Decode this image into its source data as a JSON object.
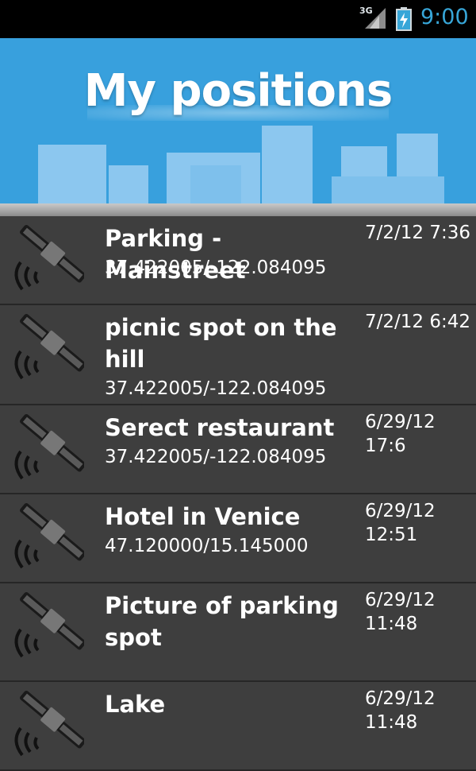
{
  "status_bar": {
    "network_label": "3G",
    "time": "9:00",
    "icons": [
      "signal-icon",
      "battery-icon"
    ]
  },
  "header": {
    "title": "My positions",
    "background_color": "#38a0dd"
  },
  "positions": [
    {
      "name": "Parking - Mainstreet",
      "coords": "37.422005/-122.084095",
      "date": "7/2/12 7:36"
    },
    {
      "name": "picnic spot on the hill",
      "coords": "37.422005/-122.084095",
      "date": "7/2/12 6:42"
    },
    {
      "name": "Serect restaurant",
      "coords": "37.422005/-122.084095",
      "date": "6/29/12\n17:6"
    },
    {
      "name": "Hotel in Venice",
      "coords": "47.120000/15.145000",
      "date": "6/29/12\n12:51"
    },
    {
      "name": "Picture of parking spot",
      "coords": "",
      "date": "6/29/12\n11:48"
    },
    {
      "name": "Lake",
      "coords": "",
      "date": "6/29/12\n11:48"
    }
  ],
  "icons": {
    "row_icon": "satellite-icon"
  }
}
